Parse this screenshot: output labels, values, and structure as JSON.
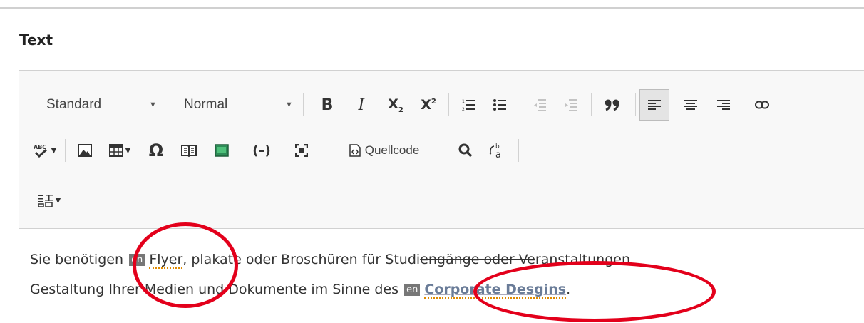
{
  "field": {
    "label": "Text"
  },
  "toolbar": {
    "style_combo": "Standard",
    "format_combo": "Normal",
    "bold": "B",
    "italic": "I",
    "subscript": "X",
    "superscript": "X",
    "blockquote": "99",
    "special_char": "Ω",
    "source_label": "Quellcode"
  },
  "content": {
    "line1": {
      "before": "Sie benötigen",
      "lang": "en",
      "term": "Flyer",
      "after_term": ", plakate oder Broschüren für Studi",
      "struck": "engänge oder Ve",
      "tail": "ranstaltungen"
    },
    "line2": {
      "before": "Gestaltung Ihrer Medien und Dokumente im Sinne des",
      "lang": "en",
      "term": "Corporate Desgins",
      "end": "."
    }
  },
  "colors": {
    "annotation": "#e3001b",
    "language_tag": "#777777",
    "spellcheck_underline": "#e08a00",
    "link_text": "#6a7c98"
  },
  "icons": [
    "chevron-down-icon",
    "bold-icon",
    "italic-icon",
    "subscript-icon",
    "superscript-icon",
    "numbered-list-icon",
    "bullet-list-icon",
    "outdent-icon",
    "indent-icon",
    "blockquote-icon",
    "align-left-icon",
    "align-center-icon",
    "align-right-icon",
    "link-icon",
    "spellcheck-icon",
    "image-icon",
    "table-icon",
    "omega-icon",
    "book-icon",
    "flag-icon",
    "hyphen-icon",
    "maximize-icon",
    "source-icon",
    "search-icon",
    "replace-icon",
    "language-icon"
  ]
}
